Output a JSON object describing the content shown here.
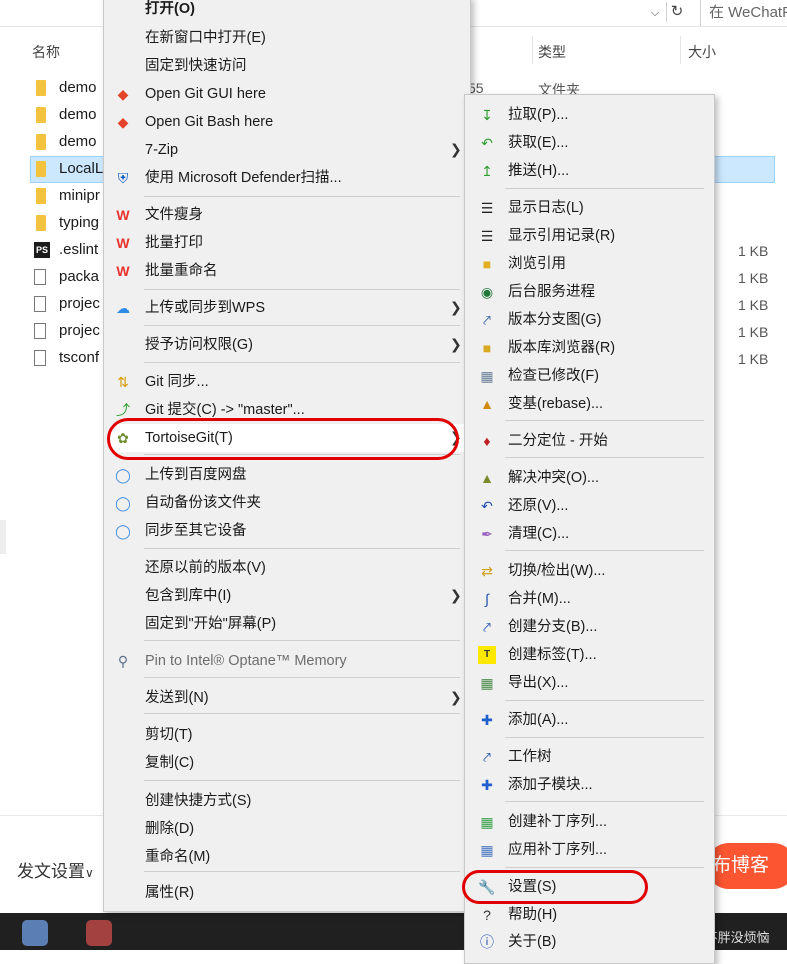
{
  "explorer": {
    "search_placeholder": "在 WeChatP",
    "dropdown_icon": "chevron-down-icon",
    "refresh_icon": "refresh-icon",
    "columns": {
      "name": "名称",
      "type": "类型",
      "size": "大小"
    },
    "files": [
      {
        "name": "demo",
        "kind": "folder"
      },
      {
        "name": "demo",
        "kind": "folder"
      },
      {
        "name": "demo",
        "kind": "folder"
      },
      {
        "name": "LocalL",
        "kind": "folder"
      },
      {
        "name": "minipr",
        "kind": "folder"
      },
      {
        "name": "typing",
        "kind": "folder"
      },
      {
        "name": ".eslint",
        "kind": "ps",
        "size": "1 KB"
      },
      {
        "name": "packa",
        "kind": "file",
        "size": "1 KB"
      },
      {
        "name": "projec",
        "kind": "file",
        "size": "1 KB"
      },
      {
        "name": "projec",
        "kind": "file",
        "size": "1 KB"
      },
      {
        "name": "tsconf",
        "kind": "file",
        "size": "1 KB"
      }
    ],
    "partial_type_text": "文件夹",
    "partial_date_text": "55"
  },
  "blog": {
    "post_settings": "发文设置",
    "publish_button": "布博客",
    "watermark": "CSDN @吃不胖没烦恼"
  },
  "main_menu": {
    "items": [
      {
        "label": "打开(O)",
        "bold": true
      },
      {
        "label": "在新窗口中打开(E)"
      },
      {
        "label": "固定到快速访问"
      },
      {
        "label": "Open Git GUI here",
        "icon": "git-diamond-icon"
      },
      {
        "label": "Open Git Bash here",
        "icon": "git-diamond-icon"
      },
      {
        "label": "7-Zip",
        "submenu": true
      },
      {
        "label": "使用 Microsoft Defender扫描...",
        "icon": "shield-icon"
      },
      {
        "label": "文件瘦身",
        "icon": "wps-icon"
      },
      {
        "label": "批量打印",
        "icon": "wps-icon"
      },
      {
        "label": "批量重命名",
        "icon": "wps-icon"
      },
      {
        "label": "上传或同步到WPS",
        "icon": "cloud-icon",
        "submenu": true
      },
      {
        "label": "授予访问权限(G)",
        "submenu": true
      },
      {
        "label": "Git 同步...",
        "icon": "git-sync-icon"
      },
      {
        "label": "Git 提交(C) -> \"master\"...",
        "icon": "git-commit-icon"
      },
      {
        "label": "TortoiseGit(T)",
        "icon": "tortoise-icon",
        "submenu": true,
        "highlighted": true
      },
      {
        "label": "上传到百度网盘",
        "icon": "baidu-icon"
      },
      {
        "label": "自动备份该文件夹",
        "icon": "baidu-icon"
      },
      {
        "label": "同步至其它设备",
        "icon": "baidu-icon"
      },
      {
        "label": "还原以前的版本(V)"
      },
      {
        "label": "包含到库中(I)",
        "submenu": true
      },
      {
        "label": "固定到\"开始\"屏幕(P)"
      },
      {
        "label": "Pin to Intel® Optane™ Memory",
        "icon": "optane-icon",
        "disabled": true
      },
      {
        "label": "发送到(N)",
        "submenu": true
      },
      {
        "label": "剪切(T)"
      },
      {
        "label": "复制(C)"
      },
      {
        "label": "创建快捷方式(S)"
      },
      {
        "label": "删除(D)"
      },
      {
        "label": "重命名(M)"
      },
      {
        "label": "属性(R)"
      }
    ]
  },
  "sub_menu": {
    "items": [
      {
        "label": "拉取(P)...",
        "icon": "pull-icon"
      },
      {
        "label": "获取(E)...",
        "icon": "fetch-icon"
      },
      {
        "label": "推送(H)...",
        "icon": "push-icon"
      },
      {
        "label": "显示日志(L)",
        "icon": "log-icon"
      },
      {
        "label": "显示引用记录(R)",
        "icon": "reflog-icon"
      },
      {
        "label": "浏览引用",
        "icon": "browse-refs-icon"
      },
      {
        "label": "后台服务进程",
        "icon": "daemon-globe-icon"
      },
      {
        "label": "版本分支图(G)",
        "icon": "revision-graph-icon"
      },
      {
        "label": "版本库浏览器(R)",
        "icon": "repo-browser-icon"
      },
      {
        "label": "检查已修改(F)",
        "icon": "check-modifications-icon"
      },
      {
        "label": "变基(rebase)...",
        "icon": "rebase-icon"
      },
      {
        "label": "二分定位 - 开始",
        "icon": "bisect-icon"
      },
      {
        "label": "解决冲突(O)...",
        "icon": "resolve-icon"
      },
      {
        "label": "还原(V)...",
        "icon": "revert-icon"
      },
      {
        "label": "清理(C)...",
        "icon": "cleanup-icon"
      },
      {
        "label": "切换/检出(W)...",
        "icon": "switch-icon"
      },
      {
        "label": "合并(M)...",
        "icon": "merge-icon"
      },
      {
        "label": "创建分支(B)...",
        "icon": "branch-icon"
      },
      {
        "label": "创建标签(T)...",
        "icon": "tag-icon"
      },
      {
        "label": "导出(X)...",
        "icon": "export-icon"
      },
      {
        "label": "添加(A)...",
        "icon": "add-icon"
      },
      {
        "label": "工作树",
        "icon": "worktree-icon"
      },
      {
        "label": "添加子模块...",
        "icon": "add-icon"
      },
      {
        "label": "创建补丁序列...",
        "icon": "create-patch-icon"
      },
      {
        "label": "应用补丁序列...",
        "icon": "apply-patch-icon"
      },
      {
        "label": "设置(S)",
        "icon": "wrench-icon",
        "annotated": true
      },
      {
        "label": "帮助(H)",
        "icon": "help-icon"
      },
      {
        "label": "关于(B)",
        "icon": "about-icon"
      }
    ]
  },
  "colors": {
    "menu_bg": "#f0f0f0",
    "selection": "#cce8ff",
    "annotation": "#e00000",
    "publish": "#fc5531"
  }
}
